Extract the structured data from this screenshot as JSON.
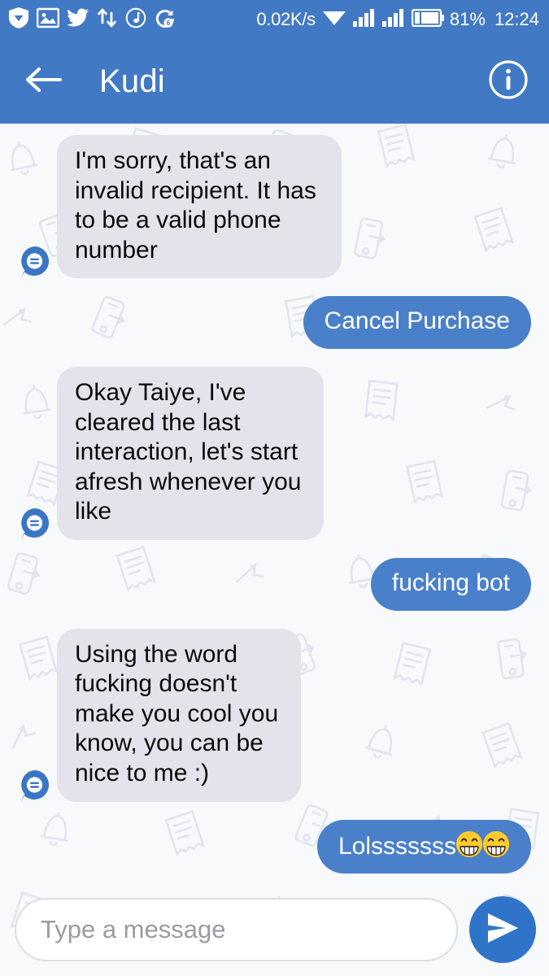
{
  "status_bar": {
    "left_icons": [
      {
        "name": "shield-icon",
        "label": "shield"
      },
      {
        "name": "image-icon",
        "label": "photo"
      },
      {
        "name": "twitter-icon",
        "label": "twitter"
      },
      {
        "name": "retweet-icon",
        "label": "retweet"
      },
      {
        "name": "music-note-icon",
        "label": "music"
      },
      {
        "name": "alarm-icon",
        "label": "alarm"
      }
    ],
    "network_speed": "0.02K/s",
    "wifi_icon": "wifi-icon",
    "signal_icons": [
      "signal-bars-icon",
      "signal-bars-icon"
    ],
    "battery_icon": "battery-icon",
    "battery_percent": "81%",
    "clock": "12:24"
  },
  "app_bar": {
    "back_icon": "back-arrow-icon",
    "title": "Kudi",
    "info_icon": "info-circle-icon"
  },
  "messages": [
    {
      "id": 1,
      "sender": "bot",
      "text": "I'm sorry, that's an invalid recipient. It has to be a valid phone number",
      "avatar": "kudi-bot-avatar"
    },
    {
      "id": 2,
      "sender": "me",
      "text": "Cancel Purchase"
    },
    {
      "id": 3,
      "sender": "bot",
      "text": "Okay Taiye, I've cleared the last interaction, let's start afresh whenever you like",
      "avatar": "kudi-bot-avatar"
    },
    {
      "id": 4,
      "sender": "me",
      "text": "fucking bot"
    },
    {
      "id": 5,
      "sender": "bot",
      "text": "Using the word fucking doesn't make you cool you know, you can be nice to me :)",
      "avatar": "kudi-bot-avatar"
    },
    {
      "id": 6,
      "sender": "me",
      "text": "Lolsssssss",
      "emoji_count": 2,
      "emoji_name": "grinning-squinting-face-emoji"
    }
  ],
  "composer": {
    "placeholder": "Type a message",
    "value": "",
    "send_icon": "send-icon"
  },
  "colors": {
    "header_blue": "#4279c4",
    "outgoing_bubble": "#4a80c9",
    "incoming_bubble": "#e4e3eb",
    "send_button": "#2f74c8",
    "chat_background": "#f8f9fb",
    "wallpaper_line": "#dfe4f0",
    "incoming_text": "#0a0a0a",
    "outgoing_text": "#ffffff",
    "placeholder_text": "#9b9ba1"
  },
  "wallpaper": {
    "name": "kudi-pattern-wallpaper",
    "motifs": [
      "phone-icon",
      "receipt-icon",
      "bell-icon",
      "arrow-icon"
    ]
  }
}
